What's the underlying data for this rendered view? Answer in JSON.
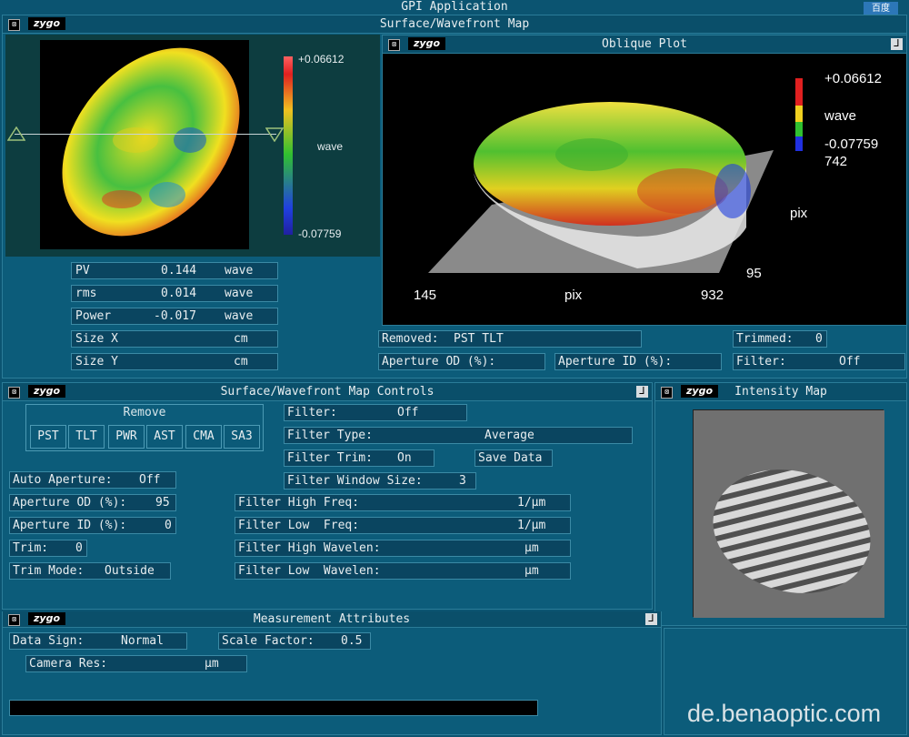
{
  "app": {
    "title": "GPI Application",
    "logo_text": "百度"
  },
  "surface_map": {
    "title": "Surface/Wavefront Map",
    "scale_max": "+0.06612",
    "scale_min": "-0.07759",
    "scale_unit": "wave",
    "stats": [
      {
        "label": "PV",
        "value": "0.144",
        "unit": "wave"
      },
      {
        "label": "rms",
        "value": "0.014",
        "unit": "wave"
      },
      {
        "label": "Power",
        "value": "-0.017",
        "unit": "wave"
      },
      {
        "label": "Size X",
        "value": "",
        "unit": "cm"
      },
      {
        "label": "Size Y",
        "value": "",
        "unit": "cm"
      }
    ]
  },
  "oblique": {
    "title": "Oblique Plot",
    "scale_max": "+0.06612",
    "scale_unit": "wave",
    "scale_min": "-0.07759",
    "y_max": "742",
    "y_label": "pix",
    "y_min": "95",
    "x_min": "145",
    "x_label": "pix",
    "x_max": "932",
    "removed_label": "Removed:",
    "removed_value": "PST TLT",
    "trimmed_label": "Trimmed:",
    "trimmed_value": "0",
    "ap_od_label": "Aperture OD (%):",
    "ap_id_label": "Aperture ID (%):",
    "filter_label": "Filter:",
    "filter_value": "Off"
  },
  "controls": {
    "title": "Surface/Wavefront Map Controls",
    "remove_label": "Remove",
    "remove_buttons": [
      "PST",
      "TLT",
      "PWR",
      "AST",
      "CMA",
      "SA3"
    ],
    "auto_aperture": {
      "label": "Auto Aperture:",
      "value": "Off"
    },
    "ap_od": {
      "label": "Aperture OD (%):",
      "value": "95"
    },
    "ap_id": {
      "label": "Aperture ID (%):",
      "value": "0"
    },
    "trim": {
      "label": "Trim:",
      "value": "0"
    },
    "trim_mode": {
      "label": "Trim Mode:",
      "value": "Outside"
    },
    "filter": {
      "label": "Filter:",
      "value": "Off"
    },
    "filter_type": {
      "label": "Filter Type:",
      "value": "Average"
    },
    "filter_trim": {
      "label": "Filter Trim:",
      "value": "On"
    },
    "save_data": "Save Data",
    "filter_window": {
      "label": "Filter Window Size:",
      "value": "3"
    },
    "high_freq": {
      "label": "Filter High Freq:",
      "unit": "1/µm"
    },
    "low_freq": {
      "label": "Filter Low  Freq:",
      "unit": "1/µm"
    },
    "high_wave": {
      "label": "Filter High Wavelen:",
      "unit": "µm"
    },
    "low_wave": {
      "label": "Filter Low  Wavelen:",
      "unit": "µm"
    }
  },
  "intensity": {
    "title": "Intensity Map"
  },
  "measurement": {
    "title": "Measurement Attributes",
    "data_sign": {
      "label": "Data Sign:",
      "value": "Normal"
    },
    "scale_factor": {
      "label": "Scale Factor:",
      "value": "0.5"
    },
    "camera_res": {
      "label": "Camera Res:",
      "unit": "µm"
    }
  },
  "zygo_label": "zygo",
  "watermark": "de.benaoptic.com"
}
